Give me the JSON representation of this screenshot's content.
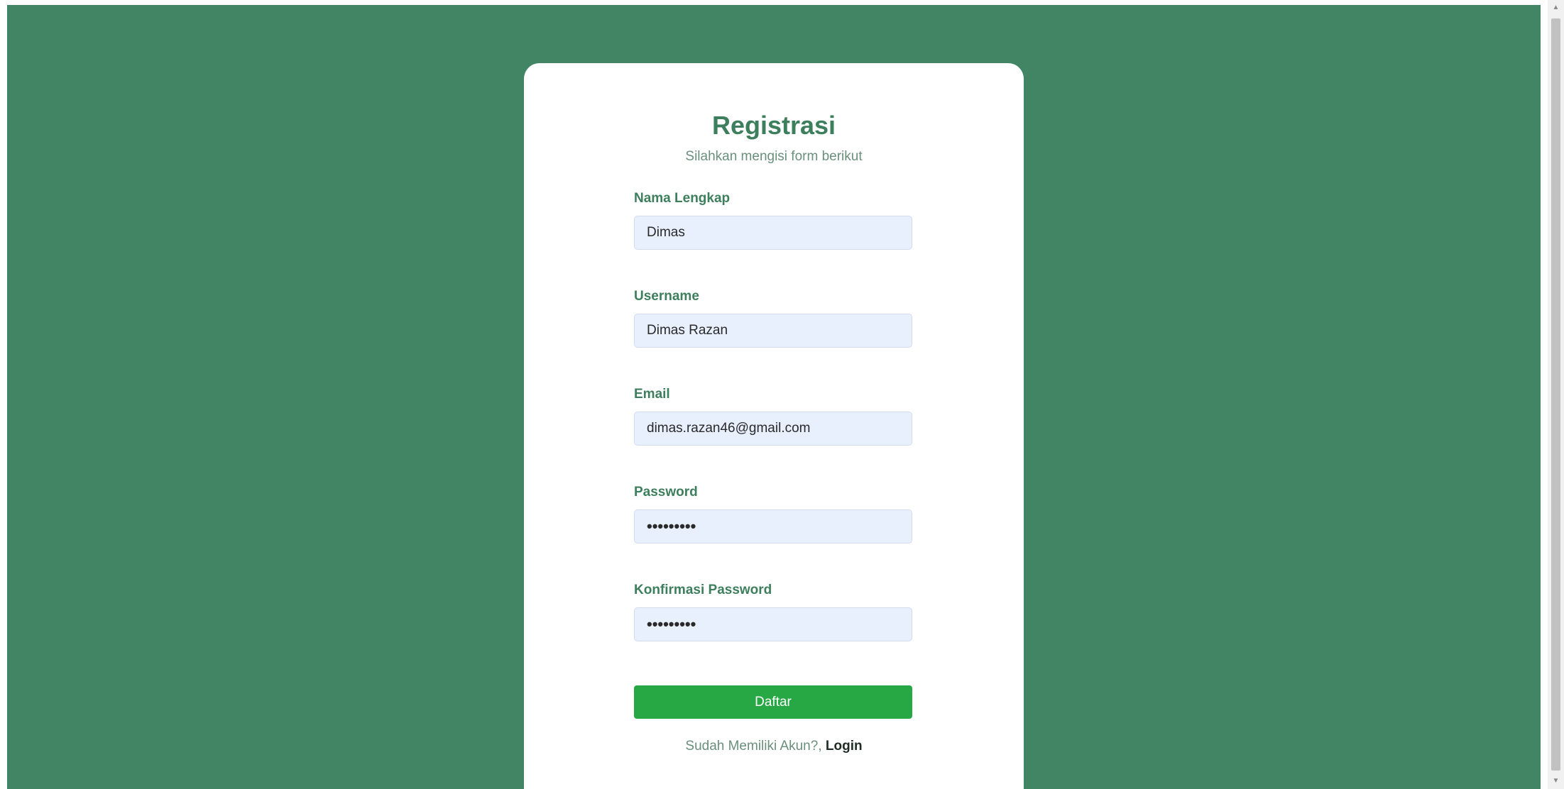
{
  "page": {
    "background_color": "#418564",
    "card_color": "#ffffff",
    "accent_color": "#3d7f5c",
    "button_color": "#28a745"
  },
  "form": {
    "title": "Registrasi",
    "subtitle": "Silahkan mengisi form berikut",
    "fields": [
      {
        "label": "Nama Lengkap",
        "value": "Dimas"
      },
      {
        "label": "Username",
        "value": "Dimas Razan"
      },
      {
        "label": "Email",
        "value": "dimas.razan46@gmail.com"
      },
      {
        "label": "Password",
        "value": "•••••••••"
      },
      {
        "label": "Konfirmasi Password",
        "value": "•••••••••"
      }
    ],
    "submit_label": "Daftar",
    "footer_text": "Sudah Memiliki Akun?, ",
    "footer_link": "Login"
  },
  "scrollbar": {
    "up_icon": "scroll-up-arrow-icon",
    "down_icon": "scroll-down-arrow-icon"
  }
}
